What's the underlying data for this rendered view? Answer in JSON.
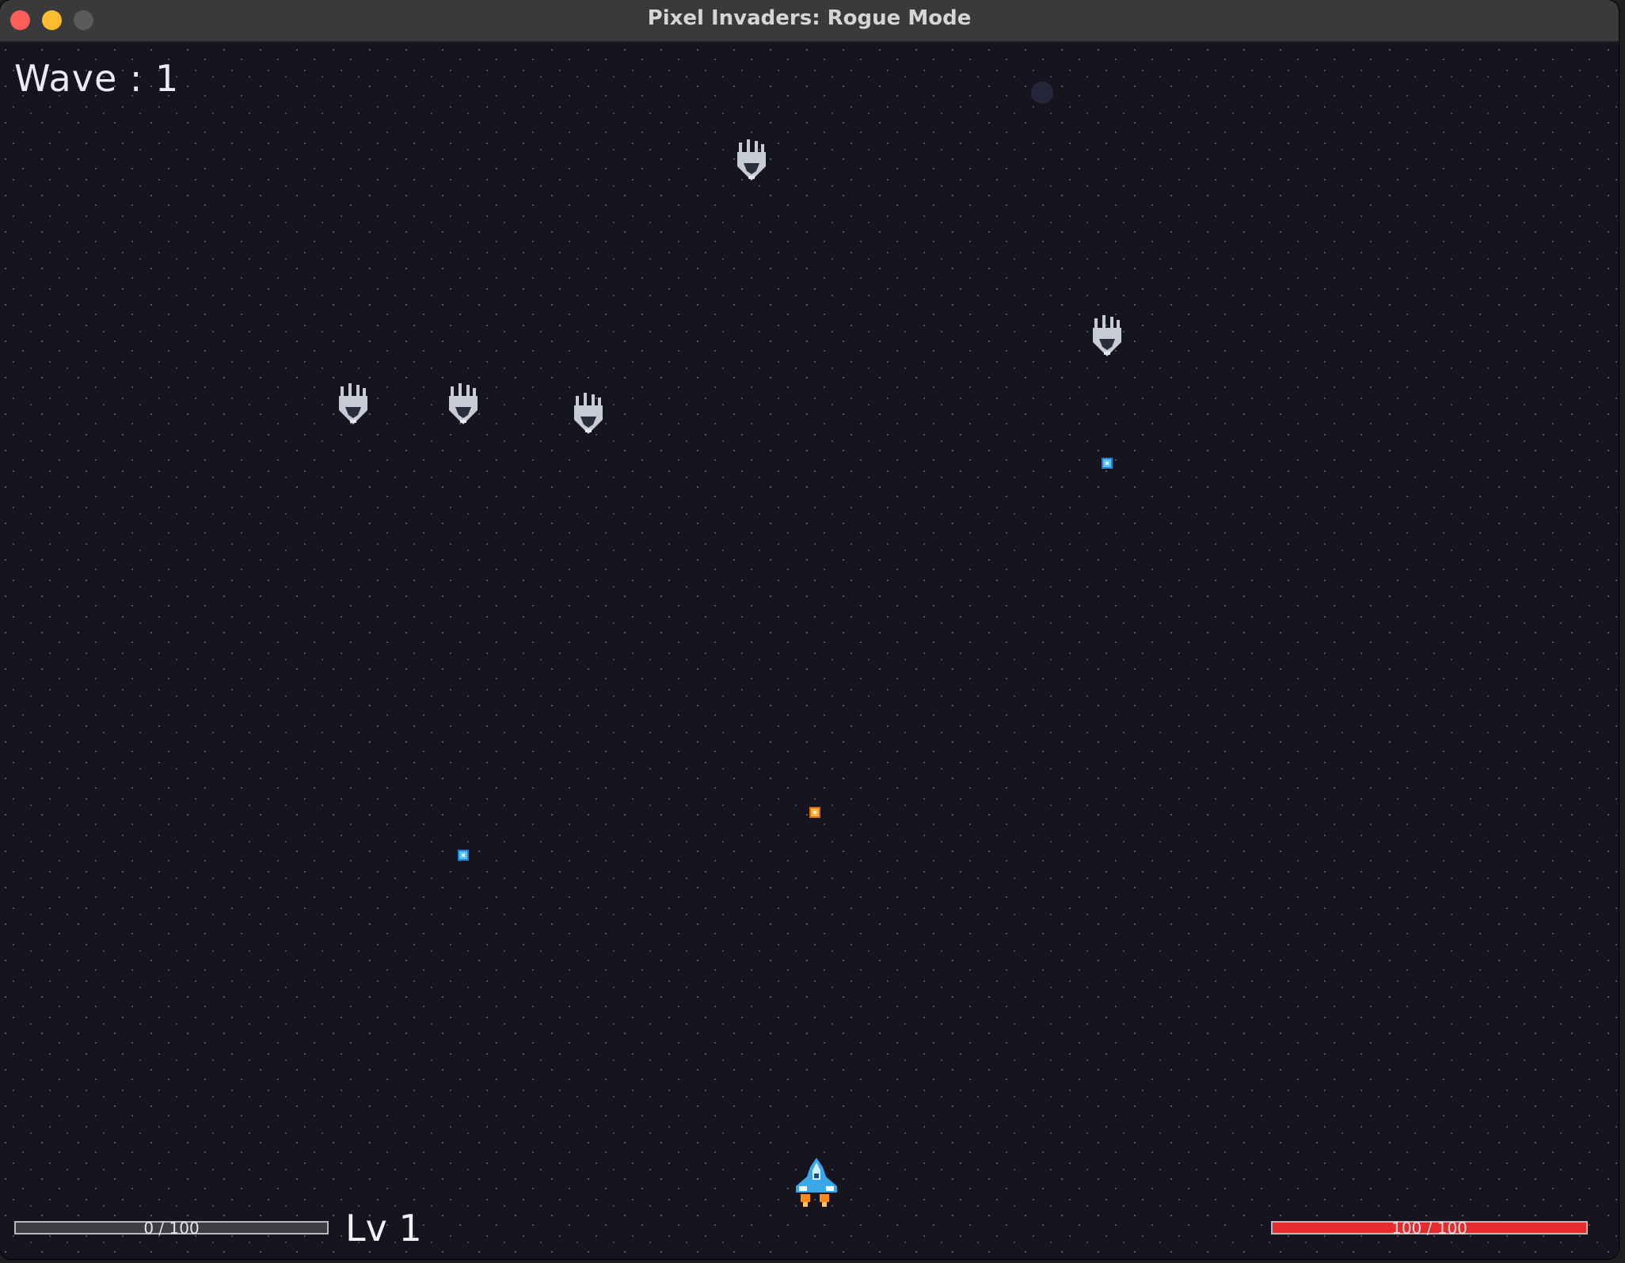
{
  "window": {
    "title": "Pixel Invaders: Rogue Mode"
  },
  "hud": {
    "wave_label": "Wave : 1",
    "level_label": "Lv 1",
    "xp": {
      "current": 0,
      "max": 100,
      "text": "0 / 100",
      "fraction": 0.0
    },
    "hp": {
      "current": 100,
      "max": 100,
      "text": "100 / 100",
      "fraction": 1.0
    }
  },
  "colors": {
    "background": "#15141f",
    "hp_fill": "#e52b2b",
    "enemy_projectile": "#2aa8ff",
    "player_projectile": "#ff9a1a",
    "enemy_body": "#c7cbd6",
    "player_body": "#39a7e8"
  },
  "entities": {
    "enemies": [
      "enemy-ship",
      "enemy-ship",
      "enemy-ship",
      "enemy-ship",
      "enemy-ship"
    ],
    "enemy_projectiles": [
      "blue-orb",
      "blue-orb"
    ],
    "player_projectiles": [
      "orange-orb"
    ],
    "player": "player-ship",
    "asteroid": "dark-asteroid"
  }
}
